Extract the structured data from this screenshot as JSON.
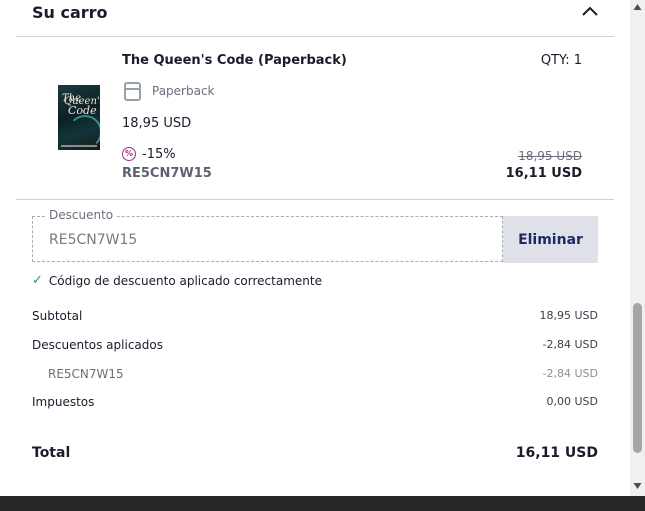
{
  "cart": {
    "title": "Su carro"
  },
  "item": {
    "title": "The Queen's Code (Paperback)",
    "qty": "QTY: 1",
    "format": "Paperback",
    "unit_price": "18,95 USD",
    "discount_pct": "-15%",
    "code": "RE5CN7W15",
    "old_price": "18,95 USD",
    "new_price": "16,11 USD",
    "cover": {
      "line1": "The",
      "line2": "Queen's",
      "line3": "Code"
    }
  },
  "discount": {
    "legend": "Descuento",
    "value": "RE5CN7W15",
    "remove_label": "Eliminar",
    "success_message": "Código de descuento aplicado correctamente"
  },
  "summary": {
    "subtotal_label": "Subtotal",
    "subtotal_value": "18,95 USD",
    "discounts_label": "Descuentos aplicados",
    "discounts_value": "-2,84 USD",
    "code_label": "RE5CN7W15",
    "code_value": "-2,84 USD",
    "taxes_label": "Impuestos",
    "taxes_value": "0,00 USD",
    "total_label": "Total",
    "total_value": "16,11 USD"
  },
  "icons": {
    "collapse": "chevron-up-icon",
    "format": "book-icon",
    "discount": "percent-badge-icon",
    "success": "check-icon"
  },
  "colors": {
    "accent": "#1e2a66",
    "discount_badge": "#a2348a",
    "success": "#2e9a4c"
  }
}
